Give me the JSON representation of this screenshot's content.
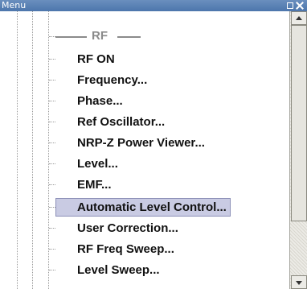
{
  "window": {
    "title": "Menu"
  },
  "menu": {
    "section_label": "RF",
    "items": [
      {
        "label": "RF ON"
      },
      {
        "label": "Frequency..."
      },
      {
        "label": "Phase..."
      },
      {
        "label": "Ref Oscillator..."
      },
      {
        "label": "NRP-Z Power Viewer..."
      },
      {
        "label": "Level..."
      },
      {
        "label": "EMF..."
      },
      {
        "label": "Automatic Level Control...",
        "selected": true
      },
      {
        "label": "User Correction..."
      },
      {
        "label": "RF Freq Sweep..."
      },
      {
        "label": "Level Sweep..."
      }
    ]
  },
  "colors": {
    "titlebar": "#5a80b3",
    "selection_bg": "#c9cbe3",
    "section_text": "#8a8a8a"
  },
  "icons": {
    "restore": "restore-icon",
    "close": "close-icon",
    "scroll_up": "arrow-up-icon",
    "scroll_down": "arrow-down-icon"
  }
}
